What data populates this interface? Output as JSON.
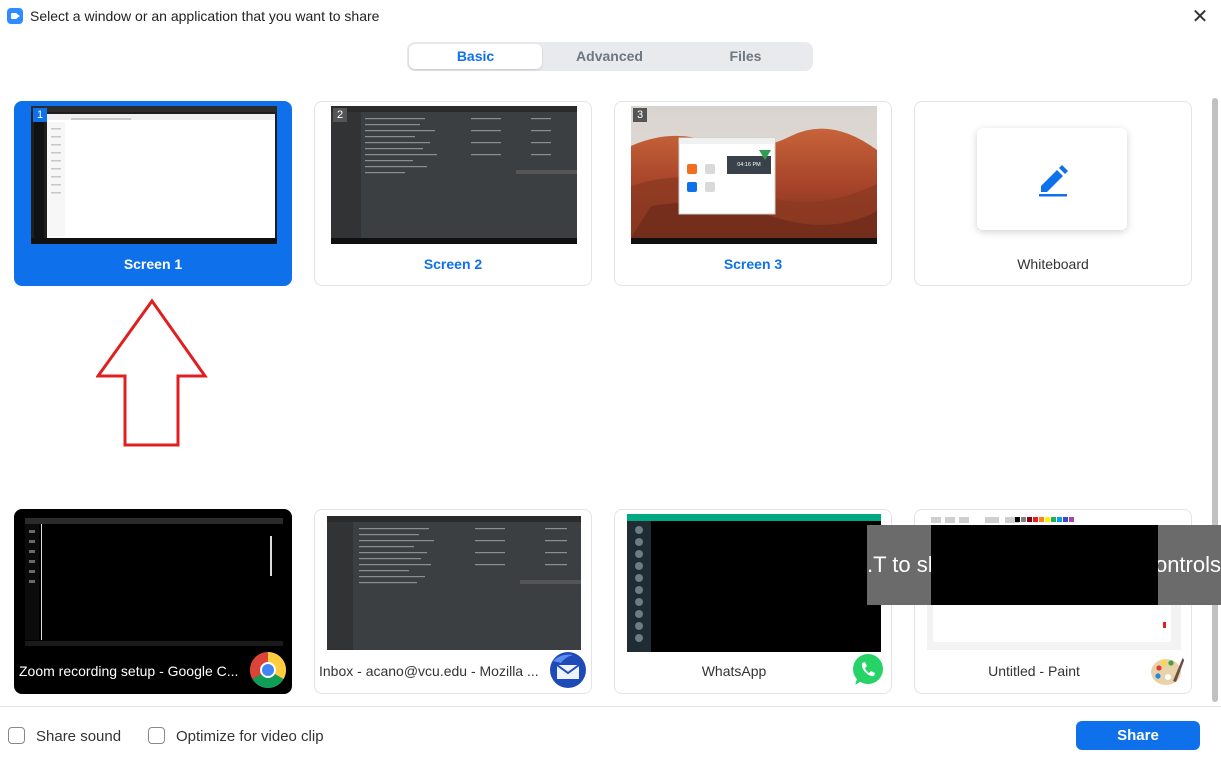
{
  "window": {
    "title": "Select a window or an application that you want to share",
    "close_glyph": "✕"
  },
  "tabs": [
    {
      "label": "Basic",
      "active": true
    },
    {
      "label": "Advanced",
      "active": false
    },
    {
      "label": "Files",
      "active": false
    }
  ],
  "screens": [
    {
      "label": "Screen 1",
      "number": "1",
      "selected": true
    },
    {
      "label": "Screen 2",
      "number": "2",
      "selected": false
    },
    {
      "label": "Screen 3",
      "number": "3",
      "selected": false
    },
    {
      "label": "Whiteboard",
      "icon": "pen-icon"
    }
  ],
  "windows": [
    {
      "label": "Zoom recording setup - Google C...",
      "icon": "chrome-icon"
    },
    {
      "label": "Inbox - acano@vcu.edu - Mozilla ...",
      "icon": "thunderbird-icon"
    },
    {
      "label": "WhatsApp",
      "icon": "whatsapp-icon"
    },
    {
      "label": "Untitled - Paint",
      "icon": "paint-icon"
    }
  ],
  "overlay_fragments": {
    "left": ".T to sh",
    "right": "ontrols"
  },
  "screen3_clock": "04:16 PM",
  "bottom": {
    "share_sound": "Share sound",
    "optimize_video": "Optimize for video clip",
    "share_button": "Share"
  },
  "colors": {
    "accent": "#0e71eb",
    "annotation_arrow": "#e02020"
  }
}
